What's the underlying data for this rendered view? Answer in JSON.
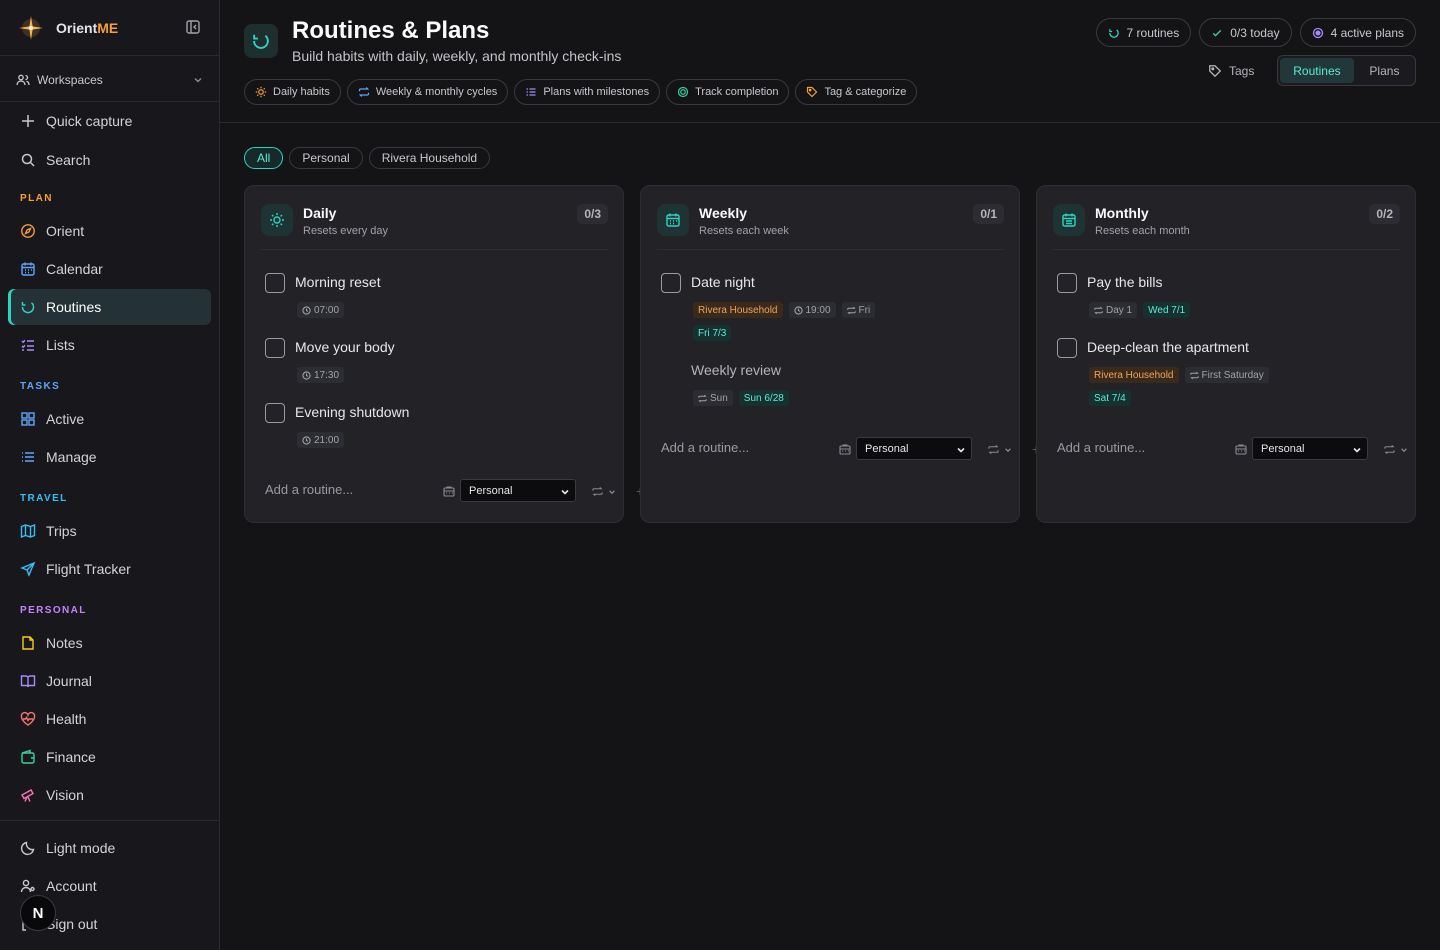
{
  "app": {
    "brand_prefix": "Orient",
    "brand_suffix": "ME"
  },
  "sidebar": {
    "workspaces_label": "Workspaces",
    "quick_capture": "Quick capture",
    "search": "Search",
    "sections": [
      {
        "label": "PLAN",
        "color": "#f59e3b"
      },
      {
        "label": "TASKS",
        "color": "#60a5fa"
      },
      {
        "label": "TRAVEL",
        "color": "#38bdf8"
      },
      {
        "label": "PERSONAL",
        "color": "#c084fc"
      }
    ],
    "plan_items": [
      {
        "label": "Orient",
        "icon": "compass-icon"
      },
      {
        "label": "Calendar",
        "icon": "calendar-icon"
      },
      {
        "label": "Routines",
        "icon": "refresh-icon",
        "active": true
      },
      {
        "label": "Lists",
        "icon": "list-check-icon"
      }
    ],
    "tasks_items": [
      {
        "label": "Active",
        "icon": "grid-icon"
      },
      {
        "label": "Manage",
        "icon": "list-icon"
      }
    ],
    "travel_items": [
      {
        "label": "Trips",
        "icon": "map-icon"
      },
      {
        "label": "Flight Tracker",
        "icon": "plane-icon"
      }
    ],
    "personal_items": [
      {
        "label": "Notes",
        "icon": "note-icon"
      },
      {
        "label": "Journal",
        "icon": "book-icon"
      },
      {
        "label": "Health",
        "icon": "heart-pulse-icon"
      },
      {
        "label": "Finance",
        "icon": "wallet-icon"
      },
      {
        "label": "Vision",
        "icon": "telescope-icon"
      }
    ],
    "footer_items": [
      {
        "label": "Light mode",
        "icon": "moon-icon"
      },
      {
        "label": "Account",
        "icon": "user-icon"
      },
      {
        "label": "Sign out",
        "icon": "logout-icon"
      }
    ],
    "avatar_letter": "N"
  },
  "header": {
    "title": "Routines & Plans",
    "subtitle": "Build habits with daily, weekly, and monthly check-ins",
    "feature_chips": [
      {
        "label": "Daily habits",
        "color": "#f59e3b"
      },
      {
        "label": "Weekly & monthly cycles",
        "color": "#60a5fa"
      },
      {
        "label": "Plans with milestones",
        "color": "#a78bfa"
      },
      {
        "label": "Track completion",
        "color": "#34d399"
      },
      {
        "label": "Tag & categorize",
        "color": "#f59e3b"
      }
    ],
    "stats": [
      {
        "label": "7 routines",
        "color": "#2dd4bf"
      },
      {
        "label": "0/3 today",
        "color": "#34d399"
      },
      {
        "label": "4 active plans",
        "color": "#a78bfa"
      }
    ],
    "tags_label": "Tags",
    "view_toggle": {
      "routines": "Routines",
      "plans": "Plans",
      "selected": "Routines"
    }
  },
  "filters": [
    {
      "label": "All",
      "active": true
    },
    {
      "label": "Personal"
    },
    {
      "label": "Rivera Household"
    }
  ],
  "columns": [
    {
      "title": "Daily",
      "subtitle": "Resets every day",
      "count": "0/3",
      "icon": "sun-icon",
      "items": [
        {
          "name": "Morning reset",
          "badges": [
            {
              "text": "07:00",
              "kind": "time"
            }
          ]
        },
        {
          "name": "Move your body",
          "badges": [
            {
              "text": "17:30",
              "kind": "time"
            }
          ]
        },
        {
          "name": "Evening shutdown",
          "badges": [
            {
              "text": "21:00",
              "kind": "time"
            }
          ]
        }
      ],
      "add_placeholder": "Add a routine...",
      "workspace": "Personal"
    },
    {
      "title": "Weekly",
      "subtitle": "Resets each week",
      "count": "0/1",
      "icon": "calendar-icon",
      "items": [
        {
          "name": "Date night",
          "badges": [
            {
              "text": "Rivera Household",
              "kind": "household"
            },
            {
              "text": "19:00",
              "kind": "time"
            },
            {
              "text": "Fri",
              "kind": "repeat"
            }
          ],
          "badges2": [
            {
              "text": "Fri 7/3",
              "kind": "date"
            }
          ]
        },
        {
          "name": "Weekly review",
          "nocheck": true,
          "badges": [
            {
              "text": "Sun",
              "kind": "repeat"
            },
            {
              "text": "Sun 6/28",
              "kind": "date"
            }
          ]
        }
      ],
      "add_placeholder": "Add a routine...",
      "workspace": "Personal"
    },
    {
      "title": "Monthly",
      "subtitle": "Resets each month",
      "count": "0/2",
      "icon": "calendar-icon",
      "items": [
        {
          "name": "Pay the bills",
          "badges": [
            {
              "text": "Day 1",
              "kind": "repeat"
            },
            {
              "text": "Wed 7/1",
              "kind": "date"
            }
          ]
        },
        {
          "name": "Deep-clean the apartment",
          "badges": [
            {
              "text": "Rivera Household",
              "kind": "household"
            },
            {
              "text": "First Saturday",
              "kind": "repeat"
            }
          ],
          "badges2": [
            {
              "text": "Sat 7/4",
              "kind": "date"
            }
          ]
        }
      ],
      "add_placeholder": "Add a routine...",
      "workspace": "Personal"
    }
  ]
}
